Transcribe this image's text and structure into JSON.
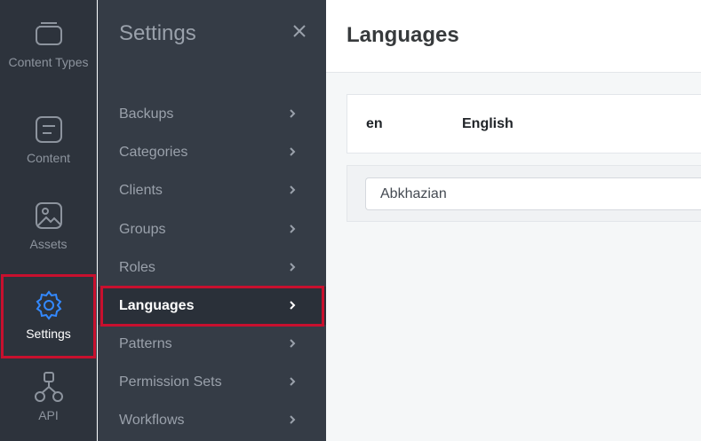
{
  "rail": {
    "items": [
      {
        "label": "Content Types",
        "icon": "content-types-icon",
        "active": false
      },
      {
        "label": "Content",
        "icon": "content-icon",
        "active": false
      },
      {
        "label": "Assets",
        "icon": "assets-icon",
        "active": false
      },
      {
        "label": "Settings",
        "icon": "gear-icon",
        "active": true
      },
      {
        "label": "API",
        "icon": "api-icon",
        "active": false
      }
    ]
  },
  "settings_panel": {
    "title": "Settings",
    "close_icon": "close-icon",
    "items": [
      {
        "label": "Backups"
      },
      {
        "label": "Categories"
      },
      {
        "label": "Clients"
      },
      {
        "label": "Groups"
      },
      {
        "label": "Roles"
      },
      {
        "label": "Languages",
        "active": true
      },
      {
        "label": "Patterns"
      },
      {
        "label": "Permission Sets"
      },
      {
        "label": "Workflows"
      }
    ]
  },
  "main": {
    "title": "Languages",
    "languages": [
      {
        "code": "en",
        "name": "English"
      }
    ],
    "add_language": {
      "value": "Abkhazian"
    }
  },
  "colors": {
    "accent": "#3389ff",
    "highlight": "#c8102e",
    "rail_bg": "#2d333c",
    "panel_bg": "#353c46"
  }
}
